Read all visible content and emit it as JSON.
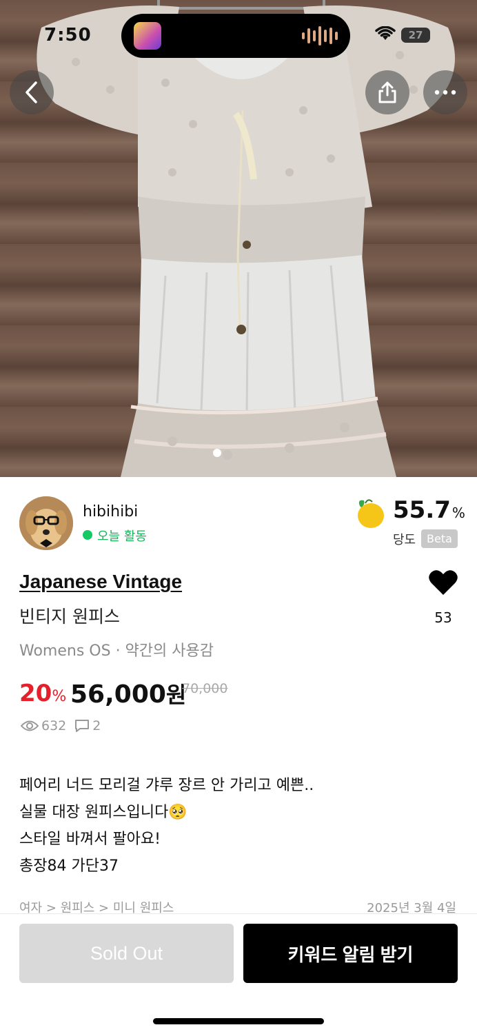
{
  "status_bar": {
    "time": "7:50",
    "battery": "27"
  },
  "nav": {
    "back_icon": "chevron-left-icon",
    "share_icon": "share-icon",
    "more_icon": "ellipsis-icon"
  },
  "gallery": {
    "current_page": 1
  },
  "seller": {
    "name": "hibihibi",
    "activity": "오늘 활동",
    "sweetness_score": "55.7",
    "sweetness_unit": "%",
    "sweetness_label": "당도",
    "beta_badge": "Beta"
  },
  "product": {
    "brand": "Japanese Vintage",
    "title": "빈티지 원피스",
    "meta": "Womens OS · 약간의 사용감",
    "discount": "20",
    "discount_unit": "%",
    "price": "56,000",
    "currency": "원",
    "original_price": "70,000",
    "views": "632",
    "comments": "2",
    "likes": "53",
    "description": [
      "페어리 너드 모리걸 갸루 장르 안 가리고 예쁜..",
      "실물 대장 원피스입니다🥺",
      "스타일 바껴서 팔아요!",
      "총장84 가단37"
    ],
    "category": "여자 > 원피스 > 미니 원피스",
    "date": "2025년 3월 4일"
  },
  "actions": {
    "sold_out": "Sold Out",
    "keyword_alert": "키워드 알림 받기"
  },
  "colors": {
    "accent_red": "#e5202a",
    "active_green": "#17c964",
    "primary_button": "#000000",
    "disabled_button": "#d9d9d9"
  }
}
